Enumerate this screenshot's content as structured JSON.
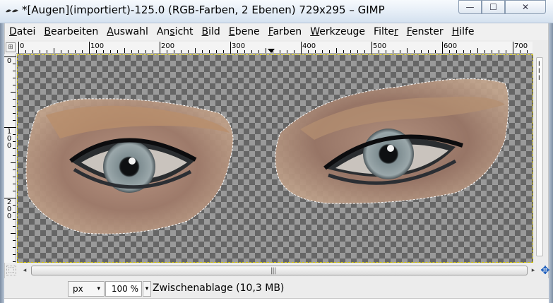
{
  "window": {
    "title": "*[Augen](importiert)-125.0 (RGB-Farben, 2 Ebenen) 729x295 – GIMP",
    "controls": {
      "minimize": "—",
      "maximize": "☐",
      "close": "✕"
    }
  },
  "menubar": {
    "items": [
      {
        "pre": "",
        "accel": "D",
        "post": "atei"
      },
      {
        "pre": "",
        "accel": "B",
        "post": "earbeiten"
      },
      {
        "pre": "",
        "accel": "A",
        "post": "uswahl"
      },
      {
        "pre": "An",
        "accel": "s",
        "post": "icht"
      },
      {
        "pre": "",
        "accel": "B",
        "post": "ild"
      },
      {
        "pre": "",
        "accel": "E",
        "post": "bene"
      },
      {
        "pre": "",
        "accel": "F",
        "post": "arben"
      },
      {
        "pre": "",
        "accel": "W",
        "post": "erkzeuge"
      },
      {
        "pre": "Filte",
        "accel": "r",
        "post": ""
      },
      {
        "pre": "",
        "accel": "F",
        "post": "enster"
      },
      {
        "pre": "",
        "accel": "H",
        "post": "ilfe"
      }
    ]
  },
  "ruler": {
    "horizontal_labels": [
      "0",
      "100",
      "200",
      "300",
      "400",
      "500",
      "600",
      "700"
    ],
    "vertical_labels": [
      "0",
      "1\n0\n0",
      "2\n0\n0"
    ],
    "right_marks": "I\nI\nI"
  },
  "statusbar": {
    "unit": "px",
    "zoom": "100 %",
    "message": "Zwischenablage (10,3 MB)"
  },
  "icons": {
    "corner": "⊞",
    "quick_mask": "⬚",
    "navigate": "✥",
    "scroll_left": "◂",
    "scroll_right": "▸",
    "dropdown": "▾",
    "grip": "|||"
  }
}
